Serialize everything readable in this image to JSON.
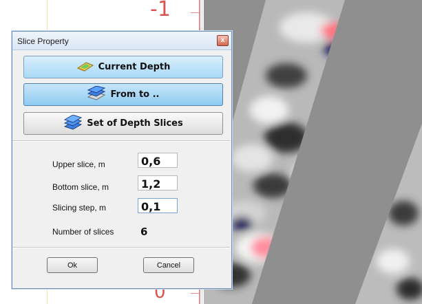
{
  "background": {
    "axis_label_top": "-1",
    "axis_label_bottom": "0"
  },
  "dialog": {
    "title": "Slice Property",
    "close_glyph": "x",
    "modes": {
      "current_depth": "Current Depth",
      "from_to": "From to ..",
      "set_of_depth_slices": "Set of Depth Slices"
    },
    "fields": {
      "upper_label": "Upper slice, m",
      "upper_value": "0,6",
      "bottom_label": "Bottom slice, m",
      "bottom_value": "1,2",
      "step_label": "Slicing step, m",
      "step_value": "0,1",
      "count_label": "Number of slices",
      "count_value": "6"
    },
    "ok_label": "Ok",
    "cancel_label": "Cancel"
  },
  "colors": {
    "axis_red": "#d9534f",
    "active_button": "#8ecbf0"
  }
}
